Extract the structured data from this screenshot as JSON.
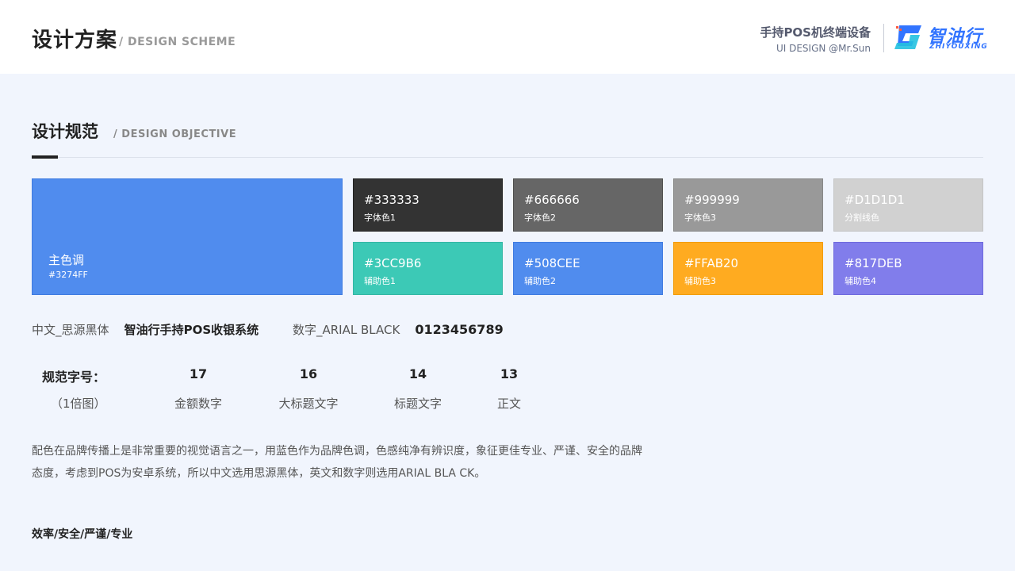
{
  "header": {
    "title": "设计方案",
    "subtitle": "/ DESIGN  SCHEME",
    "project_title": "手持POS机终端设备",
    "credit": "UI DESIGN @Mr.Sun",
    "logo_text": "智油行",
    "logo_sub": "ZHIYOUXING",
    "logo_icon": "zhiyouxing-logo-icon"
  },
  "section": {
    "title": "设计规范",
    "subtitle": "/ DESIGN  OBJECTIVE"
  },
  "primary_color": {
    "name": "主色调",
    "hex": "#3274FF",
    "display_color": "#508CEE"
  },
  "swatches": [
    {
      "hex": "#333333",
      "name": "字体色1",
      "color": "#333333"
    },
    {
      "hex": "#666666",
      "name": "字体色2",
      "color": "#666666"
    },
    {
      "hex": "#999999",
      "name": "字体色3",
      "color": "#999999"
    },
    {
      "hex": "#D1D1D1",
      "name": "分割线色",
      "color": "#D1D1D1"
    },
    {
      "hex": "#3CC9B6",
      "name": "辅助色1",
      "color": "#3CC9B6"
    },
    {
      "hex": "#508CEE",
      "name": "辅助色2",
      "color": "#508CEE"
    },
    {
      "hex": "#FFAB20",
      "name": "辅助色3",
      "color": "#FFAB20"
    },
    {
      "hex": "#817DEB",
      "name": "辅助色4",
      "color": "#817DEB"
    }
  ],
  "fonts": {
    "cn_label": "中文_思源黑体",
    "cn_sample": "智油行手持POS收银系统",
    "num_label": "数字_ARIAL  BLACK",
    "num_sample": "0123456789"
  },
  "sizes": {
    "label": "规范字号：",
    "sublabel": "（1倍图）",
    "items": [
      {
        "size": "17",
        "desc": "金额数字"
      },
      {
        "size": "16",
        "desc": "大标题文字"
      },
      {
        "size": "14",
        "desc": "标题文字"
      },
      {
        "size": "13",
        "desc": "正文"
      }
    ]
  },
  "paragraph": {
    "line1": "配色在品牌传播上是非常重要的视觉语言之一，用蓝色作为品牌色调，色感纯净有辨识度，象征更佳专业、严谨、安全的品牌",
    "line2": "态度，考虑到POS为安卓系统，所以中文选用思源黑体，英文和数字则选用ARIAL BLA CK。"
  },
  "keywords": "效率/安全/严谨/专业"
}
